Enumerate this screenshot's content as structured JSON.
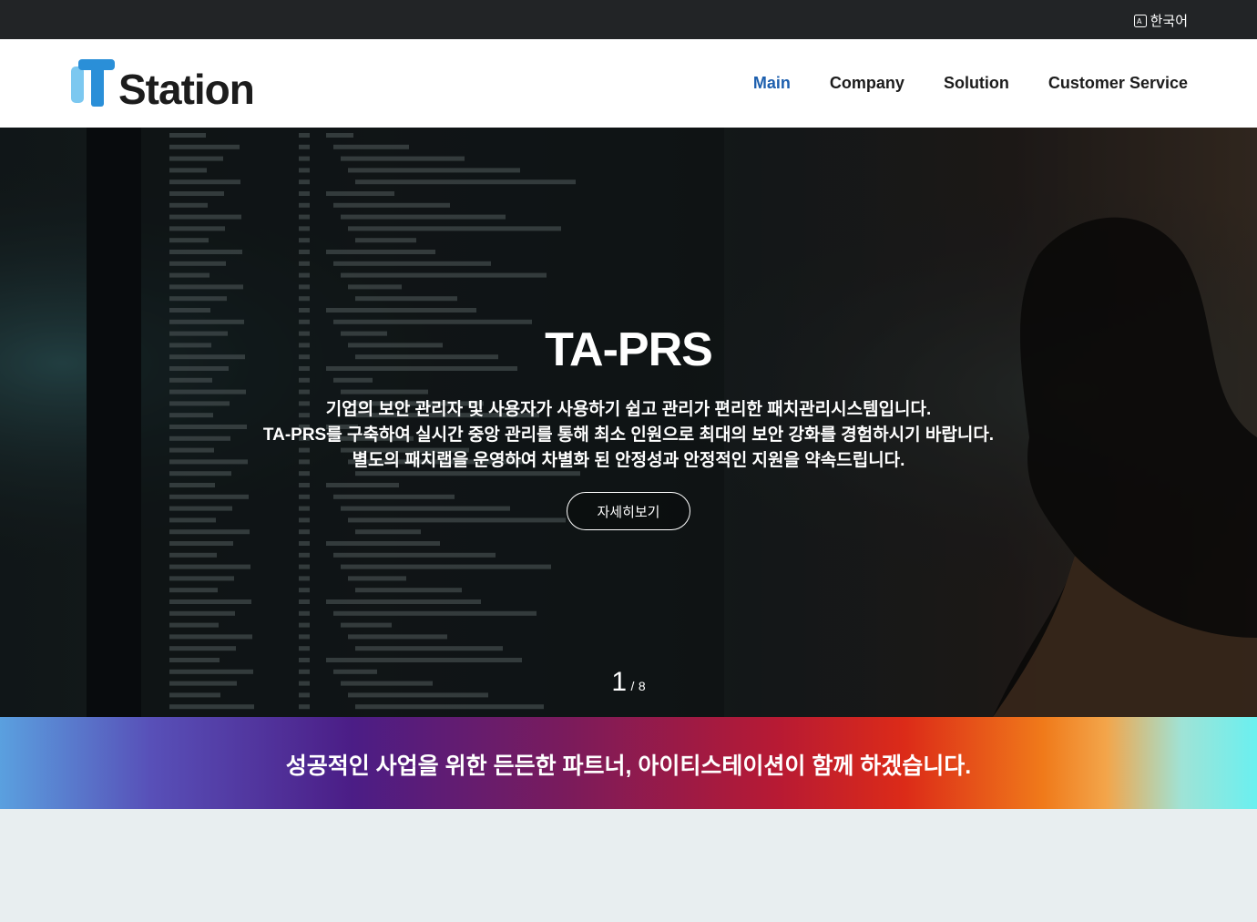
{
  "topbar": {
    "language_label": "한국어",
    "language_icon": "translate-icon"
  },
  "header": {
    "logo_text": "Station",
    "nav": [
      {
        "label": "Main",
        "active": true
      },
      {
        "label": "Company",
        "active": false
      },
      {
        "label": "Solution",
        "active": false
      },
      {
        "label": "Customer Service",
        "active": false
      }
    ]
  },
  "hero": {
    "title": "TA-PRS",
    "description": [
      "기업의 보안 관리자 및 사용자가 사용하기 쉽고 관리가 편리한 패치관리시스템입니다.",
      "TA-PRS를 구축하여 실시간 중앙 관리를 통해 최소 인원으로 최대의 보안 강화를 경험하시기 바랍니다.",
      "별도의 패치랩을 운영하여 차별화 된 안정성과 안정적인 지원을 약속드립니다."
    ],
    "button_label": "자세히보기",
    "pager": {
      "current": "1",
      "separator": "/",
      "total": "8"
    }
  },
  "banner": {
    "text": "성공적인 사업을 위한 든든한 파트너, 아이티스테이션이 함께 하겠습니다."
  },
  "colors": {
    "accent": "#1d5fae",
    "topbar": "#222426",
    "logo_blue": "#2a8fd8",
    "logo_light": "#7cc8f0"
  }
}
